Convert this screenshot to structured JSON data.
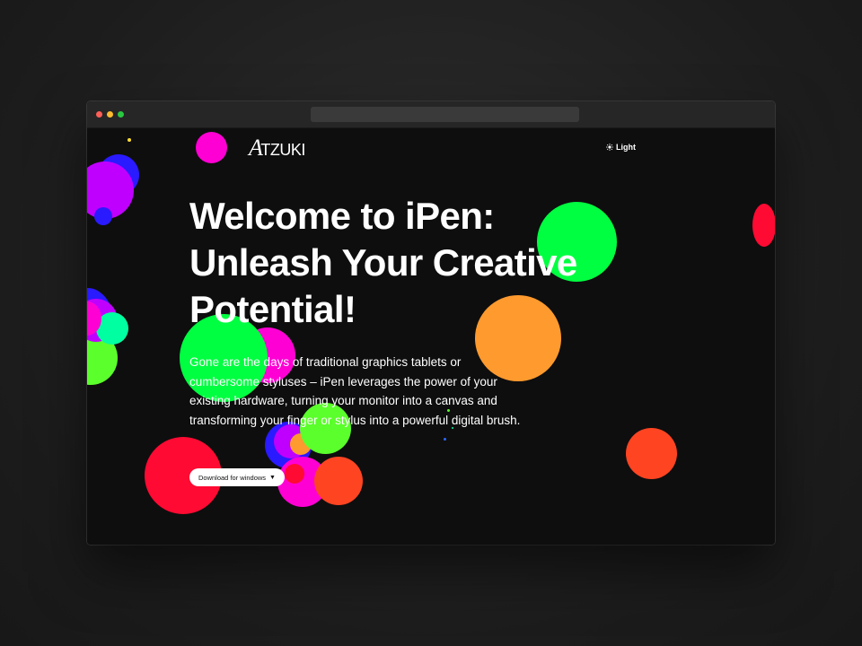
{
  "brand": {
    "logo_text": "TZUKI",
    "logo_initial": "A"
  },
  "header": {
    "theme_toggle_label": "Light",
    "theme_icon": "sun-icon"
  },
  "hero": {
    "headline": "Welcome to iPen: Unleash Your Creative Potential!",
    "description": "Gone are the days of traditional graphics tablets or cumbersome styluses – iPen leverages the power of your existing hardware, turning your monitor into a canvas and transforming your finger or stylus into a powerful digital brush.",
    "download_label": "Download for windows",
    "download_icon": "caret-down-icon"
  },
  "colors": {
    "background": "#0e0e0e",
    "text": "#ffffff",
    "paint_green": "#00ff40",
    "paint_orange": "#ff9a2e",
    "paint_red": "#ff0a32",
    "paint_magenta": "#ff00d4",
    "paint_purple": "#c000ff",
    "paint_blue": "#2a1aff",
    "paint_lime": "#5bff2b",
    "paint_red_orange": "#ff4422"
  }
}
